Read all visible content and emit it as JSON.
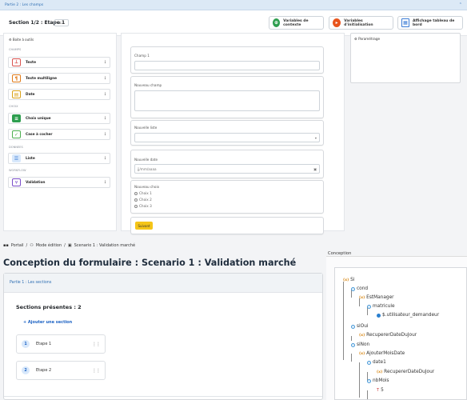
{
  "part_bar": {
    "label": "Partie 2 : Les champs"
  },
  "section_bar": {
    "title": "Section 1/2 : Etape 1",
    "select_value": "⇅ ▾",
    "context_btn": "Variables de contexte",
    "init_btn": "Variables d'initialisation",
    "dashboard_btn": "Affichage tableau de bord"
  },
  "toolbox": {
    "header": "Boite à outils",
    "cat_champs": "CHAMPS",
    "cat_choix": "CHOIX",
    "cat_donnees": "DONNEES",
    "cat_workflow": "WORKFLOW",
    "items": [
      {
        "label": "Texte",
        "icon": "text-icon",
        "color": "#d9534f"
      },
      {
        "label": "Texte multiligne",
        "icon": "multiline-text-icon",
        "color": "#e07b1a"
      },
      {
        "label": "Date",
        "icon": "calendar-icon",
        "color": "#d9a21a"
      },
      {
        "label": "Choix unique",
        "icon": "list-choice-icon",
        "color": "#2e9e4f"
      },
      {
        "label": "Case à cocher",
        "icon": "checkbox-icon",
        "color": "#4caf50"
      },
      {
        "label": "Liste",
        "icon": "list-icon",
        "color": "#3a7bd5"
      },
      {
        "label": "Validation",
        "icon": "workflow-icon",
        "color": "#7b4fc9"
      }
    ]
  },
  "form": {
    "champ1_label": "Champ 1",
    "nouveau_champ_label": "Nouveau champ",
    "nouvelle_liste_label": "Nouvelle liste",
    "nouvelle_date_label": "Nouvelle date",
    "date_placeholder": "jj/mm/aaaa",
    "nouveau_choix_label": "Nouveau choix",
    "choix": [
      "Choix 1",
      "Choix 2",
      "Choix 3"
    ],
    "submit": "Suivant"
  },
  "params": {
    "label": "Paramétrage"
  },
  "breadcrumb": {
    "portal": "Portail",
    "mode": "Mode édition",
    "scenario": "Scenario 1 : Validation marché"
  },
  "page_title": "Conception du formulaire : Scenario 1 : Validation marché",
  "sections": {
    "header": "Partie 1 : Les sections",
    "present": "Sections présentes : 2",
    "add": "+ Ajouter une section",
    "items": [
      {
        "num": "1",
        "label": "Etape 1"
      },
      {
        "num": "2",
        "label": "Etape 2"
      }
    ]
  },
  "conception": {
    "label": "Conception",
    "si": "Si",
    "cond": "cond",
    "estmanager": "EstManager",
    "matricule": "matricule",
    "user": "$.utilisateur_demandeur",
    "sioui": "siOui",
    "recup1": "RecupererDateDuJour",
    "sinon": "siNon",
    "ajouter": "AjouterMoisDate",
    "date1": "date1",
    "recup2": "RecupererDateDuJour",
    "nbmois": "nbMois",
    "five": "5",
    "fx": "(ⅹ)"
  }
}
